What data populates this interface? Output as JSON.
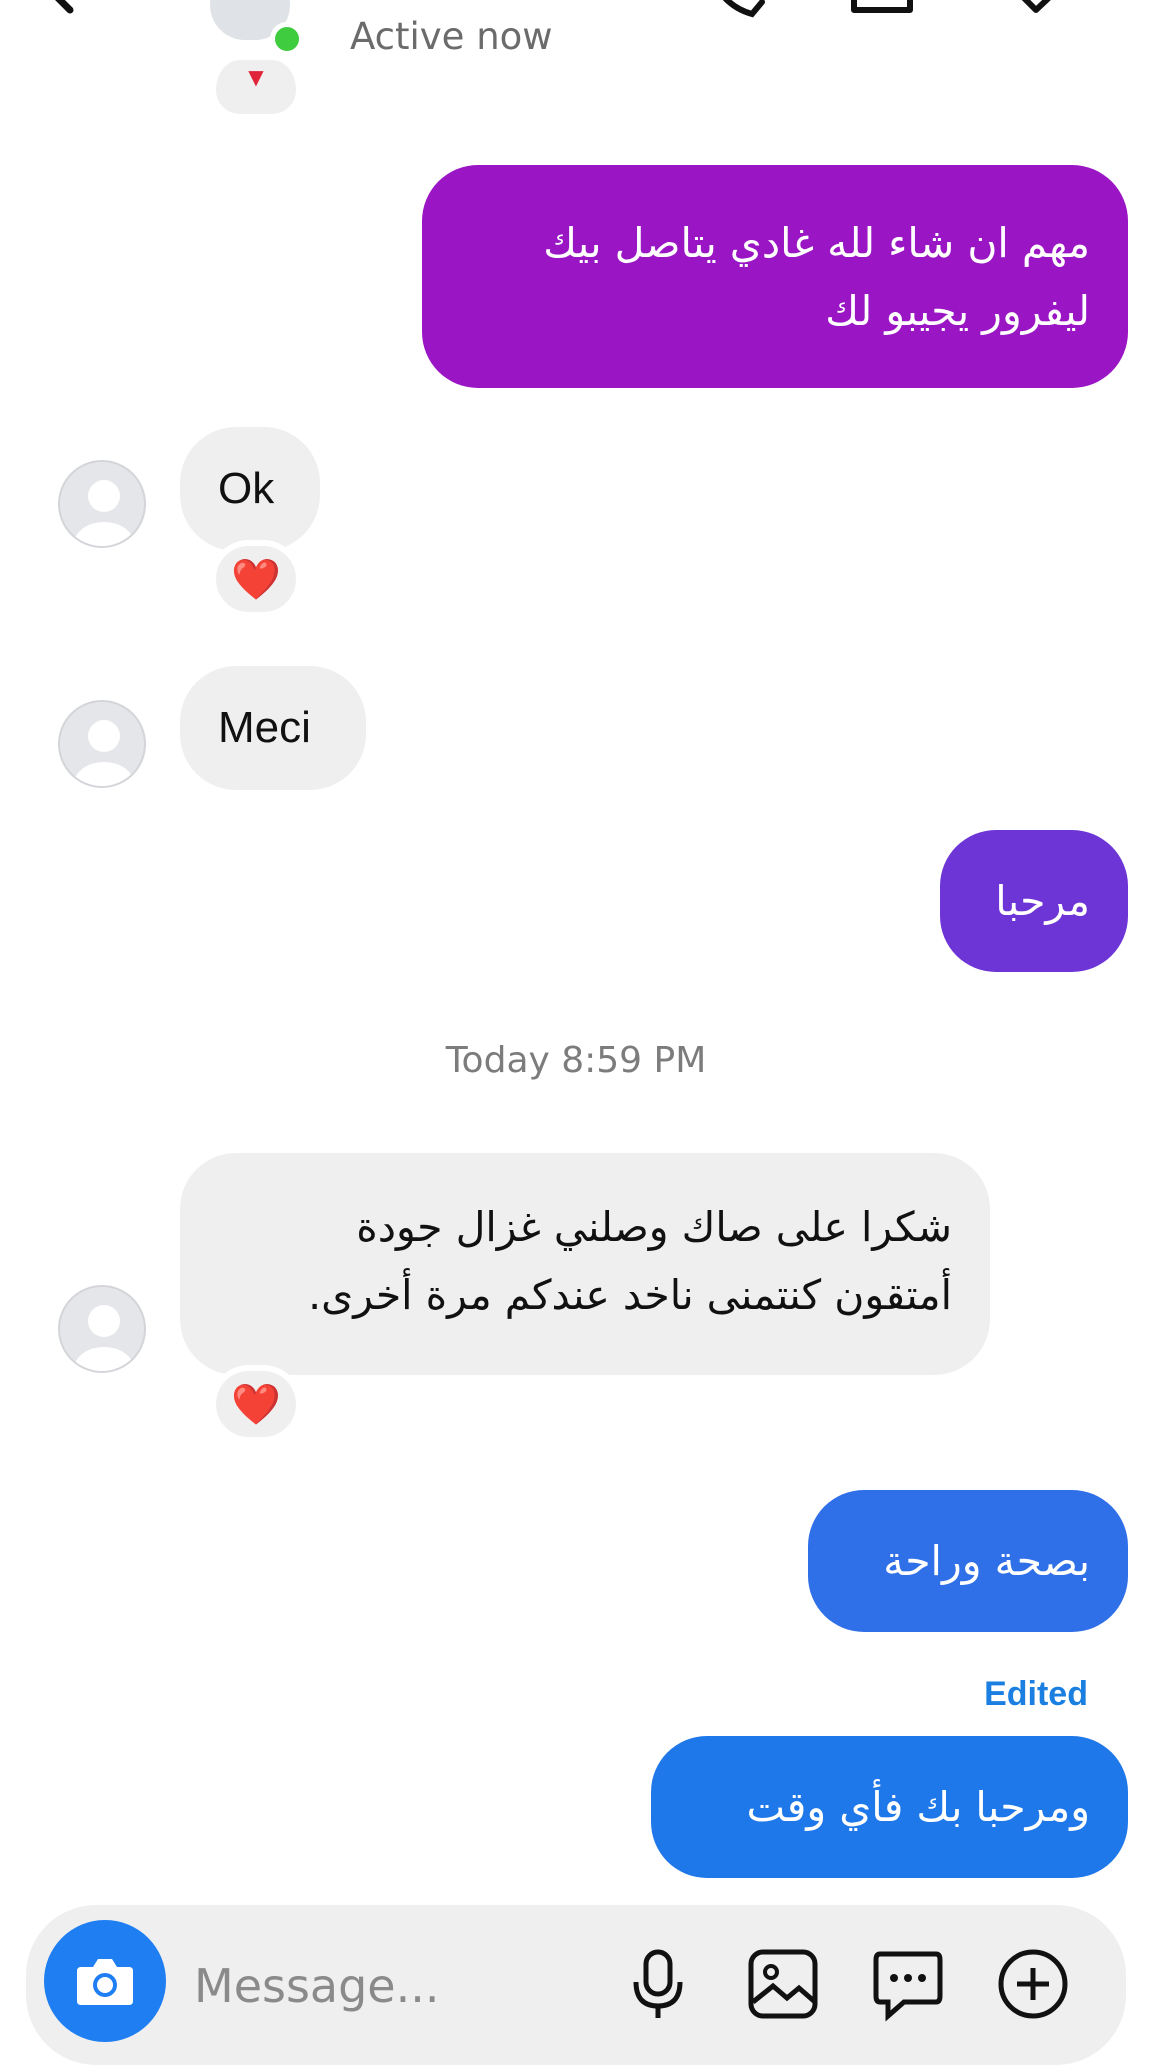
{
  "header": {
    "status": "Active now",
    "icons": [
      "back-arrow-icon",
      "phone-icon",
      "video-icon",
      "tag-icon"
    ]
  },
  "messages": [
    {
      "direction": "out",
      "lines": [
        "مهم ان شاء لله غادي يتاصل بيك",
        "ليفرور يجيبو لك"
      ],
      "color": "#9a15c4"
    },
    {
      "direction": "in",
      "text": "Ok",
      "reaction": "❤️"
    },
    {
      "direction": "in",
      "text": "Meci"
    },
    {
      "direction": "out",
      "text": "مرحبا",
      "color": "#6e35d6"
    },
    {
      "direction": "in",
      "lines": [
        "شكرا على صاك وصلني غزال جودة",
        "أمتقون كنتمنى ناخد عندكم مرة أخرى."
      ],
      "reaction": "❤️"
    },
    {
      "direction": "out",
      "text": "بصحة وراحة",
      "color": "#2f6fe8"
    },
    {
      "direction": "out",
      "text": "ومرحبا بك فأي وقت",
      "color": "#1f78ea",
      "edited": "Edited"
    }
  ],
  "timestamp": "Today 8:59 PM",
  "composer": {
    "placeholder": "Message...",
    "icons": [
      "camera-icon",
      "microphone-icon",
      "gallery-icon",
      "sticker-chat-icon",
      "plus-icon"
    ]
  },
  "colors": {
    "incoming_bubble": "#efefef",
    "online": "#3fcc3f",
    "camera_button": "#1e7ef2",
    "edited": "#1a7fe0"
  }
}
